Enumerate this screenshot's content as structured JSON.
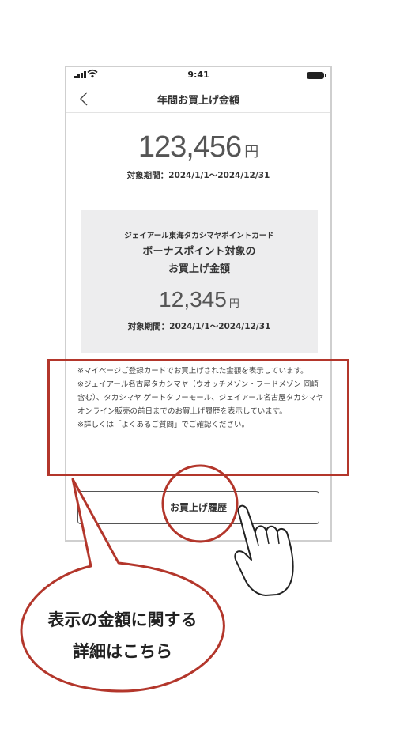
{
  "status_bar": {
    "time": "9:41"
  },
  "nav": {
    "title": "年間お買上げ金額"
  },
  "total": {
    "amount": "123,456",
    "unit": "円",
    "period": "対象期間：2024/1/1〜2024/12/31"
  },
  "bonus": {
    "card_name": "ジェイアール東海タカシマヤポイントカード",
    "title_line1": "ボーナスポイント対象の",
    "title_line2": "お買上げ金額",
    "amount": "12,345",
    "unit": "円",
    "period": "対象期間：2024/1/1〜2024/12/31"
  },
  "notes": [
    "※マイページご登録カードでお買上げされた金額を表示しています。",
    "※ジェイアール名古屋タカシマヤ（ウオッチメゾン・フードメゾン 岡崎含む）、タカシマヤ ゲートタワーモール、ジェイアール名古屋タカシマヤオンライン販売の前日までのお買上げ履歴を表示しています。",
    "※詳しくは「よくあるご質問」でご確認ください。"
  ],
  "history_button": {
    "label": "お買上げ履歴"
  },
  "callout": {
    "line1": "表示の金額に関する",
    "line2": "詳細はこちら"
  },
  "colors": {
    "annotation_red": "#b3362b",
    "box_gray": "#ededee"
  },
  "icons": [
    "signal-icon",
    "wifi-icon",
    "battery-icon",
    "back-chevron-icon",
    "pointing-hand-icon"
  ]
}
